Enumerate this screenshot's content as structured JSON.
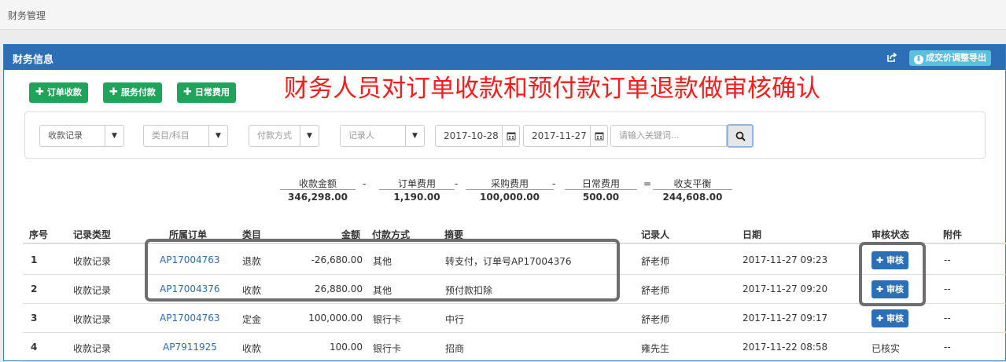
{
  "breadcrumb": "财务管理",
  "panel": {
    "title": "财务信息",
    "export_label": "成交价调整导出",
    "export_icon": "download-circle-icon",
    "header_color": "#2c6fb6"
  },
  "actions": [
    {
      "label": "订单收款"
    },
    {
      "label": "服务付款"
    },
    {
      "label": "日常费用"
    }
  ],
  "annotation": "财务人员对订单收款和预付款订单退款做审核确认",
  "filters": {
    "record_type": "收款记录",
    "category_placeholder": "类目/科目",
    "payment_placeholder": "付款方式",
    "recorder_placeholder": "记录人",
    "date_from": "2017-10-28",
    "date_to": "2017-11-27",
    "keyword_placeholder": "请输入关键词..."
  },
  "summary": {
    "items": [
      {
        "label": "收款金额",
        "value": "346,298.00"
      },
      {
        "label": "订单费用",
        "value": "1,190.00"
      },
      {
        "label": "采购费用",
        "value": "100,000.00"
      },
      {
        "label": "日常费用",
        "value": "500.00"
      },
      {
        "label": "收支平衡",
        "value": "244,608.00"
      }
    ],
    "ops": [
      "-",
      "-",
      "-",
      "="
    ]
  },
  "table": {
    "headers": [
      "序号",
      "记录类型",
      "所属订单",
      "类目",
      "金额",
      "付款方式",
      "摘要",
      "记录人",
      "日期",
      "审核状态",
      "附件"
    ],
    "rows": [
      {
        "idx": "1",
        "type": "收款记录",
        "order": "AP17004763",
        "category": "退款",
        "amount": "-26,680.00",
        "method": "其他",
        "summary": "转支付，订单号AP17004376",
        "recorder": "舒老师",
        "date": "2017-11-27 09:23",
        "status": "审核",
        "attach": "--"
      },
      {
        "idx": "2",
        "type": "收款记录",
        "order": "AP17004376",
        "category": "收款",
        "amount": "26,880.00",
        "method": "其他",
        "summary": "预付款扣除",
        "recorder": "舒老师",
        "date": "2017-11-27 09:20",
        "status": "审核",
        "attach": "--"
      },
      {
        "idx": "3",
        "type": "收款记录",
        "order": "AP17004763",
        "category": "定金",
        "amount": "100,000.00",
        "method": "银行卡",
        "summary": "中行",
        "recorder": "舒老师",
        "date": "2017-11-27 09:17",
        "status": "审核",
        "attach": "--"
      },
      {
        "idx": "4",
        "type": "收款记录",
        "order": "AP7911925",
        "category": "收款",
        "amount": "100.00",
        "method": "银行卡",
        "summary": "招商",
        "recorder": "雍先生",
        "date": "2017-11-22 08:58",
        "status": "已核实",
        "attach": "--"
      }
    ]
  },
  "colors": {
    "green_button": "#1fa55a",
    "audit_button": "#2c6fb6",
    "annotation_red": "#ff1a1a",
    "link_blue": "#2a6cb0"
  }
}
